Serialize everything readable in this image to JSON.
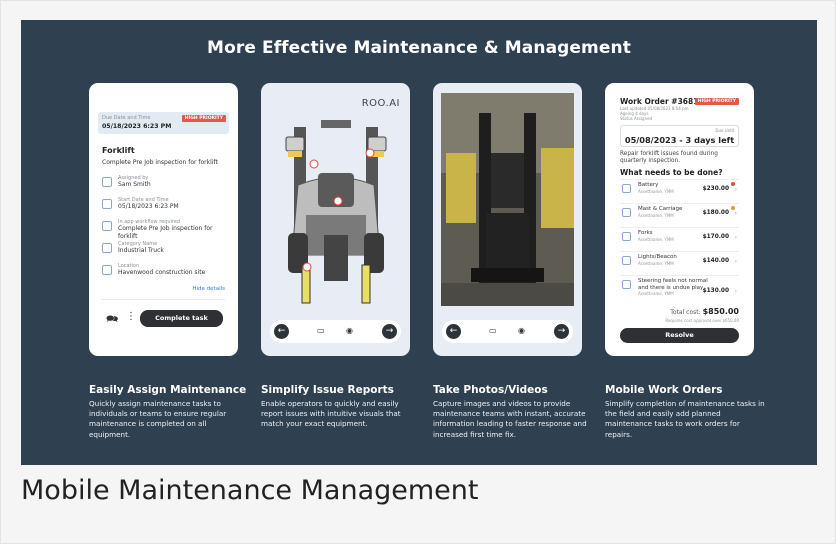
{
  "page": {
    "hero_title": "More Effective Maintenance & Management",
    "caption": "Mobile Maintenance Management"
  },
  "phone1": {
    "due_label": "Due Date and Time",
    "due_value": "05/18/2023 6:23 PM",
    "priority_badge": "HIGH PRIORITY",
    "title": "Forklift",
    "subtitle": "Complete Pre Job inspection for forklift",
    "rows": [
      {
        "label": "Assigned by",
        "value": "Sam Smith",
        "icon": "user-icon"
      },
      {
        "label": "Start Date and Time",
        "value": "05/18/2023 6:23 PM",
        "icon": "calendar-icon"
      },
      {
        "label": "In app workflow required",
        "value": "Complete Pre Job inspection for forklift",
        "icon": "workflow-icon"
      },
      {
        "label": "Category Name",
        "value": "Industrial Truck",
        "icon": "truck-icon"
      },
      {
        "label": "Location",
        "value": "Havenwood construction site",
        "icon": "location-icon"
      }
    ],
    "hide_details": "Hide details",
    "complete_task": "Complete task"
  },
  "phone2": {
    "brand": "ROO.AI"
  },
  "phone4": {
    "work_order": "Work Order #36814",
    "badge": "HIGH PRIORITY",
    "meta1": "Last updated 05/08/2023 8:54 pm",
    "meta2": "Ageing 4 days",
    "meta3": "Status Assigned",
    "due_label": "Due Until",
    "due": "05/08/2023 - 3 days left",
    "desc": "Repair forklift issues found during quarterly inspection.",
    "question": "What needs to be done?",
    "items": [
      {
        "name": "Battery",
        "who": "Assettname, YMM",
        "price": "$230.00",
        "dot": "#e24a3b"
      },
      {
        "name": "Mast & Carriage",
        "who": "Assettname, YMM",
        "price": "$180.00",
        "dot": "#e29a3b"
      },
      {
        "name": "Forks",
        "who": "Assettname, YMM",
        "price": "$170.00",
        "dot": ""
      },
      {
        "name": "Lights/Beacon",
        "who": "Assettname, YMM",
        "price": "$140.00",
        "dot": ""
      },
      {
        "name": "Steering feels not normal and there is undue play",
        "who": "Assettname, YMM",
        "price": "$130.00",
        "dot": ""
      }
    ],
    "total_label": "Total cost:",
    "total_value": "$850.00",
    "requires": "Requires cost approval over $650.00",
    "resolve": "Resolve"
  },
  "columns": [
    {
      "title": "Easily Assign Maintenance",
      "body": "Quickly assign maintenance tasks to individuals or teams to ensure regular maintenance is completed on all equipment."
    },
    {
      "title": "Simplify Issue Reports",
      "body": "Enable operators to quickly and easily report issues with intuitive visuals that match your exact equipment."
    },
    {
      "title": "Take Photos/Videos",
      "body": "Capture images and videos to provide maintenance teams with instant, accurate information leading to faster response and increased first time fix."
    },
    {
      "title": "Mobile Work Orders",
      "body": "Simplify completion of maintenance tasks in the field and easily add planned maintenance tasks to work orders for repairs."
    }
  ]
}
